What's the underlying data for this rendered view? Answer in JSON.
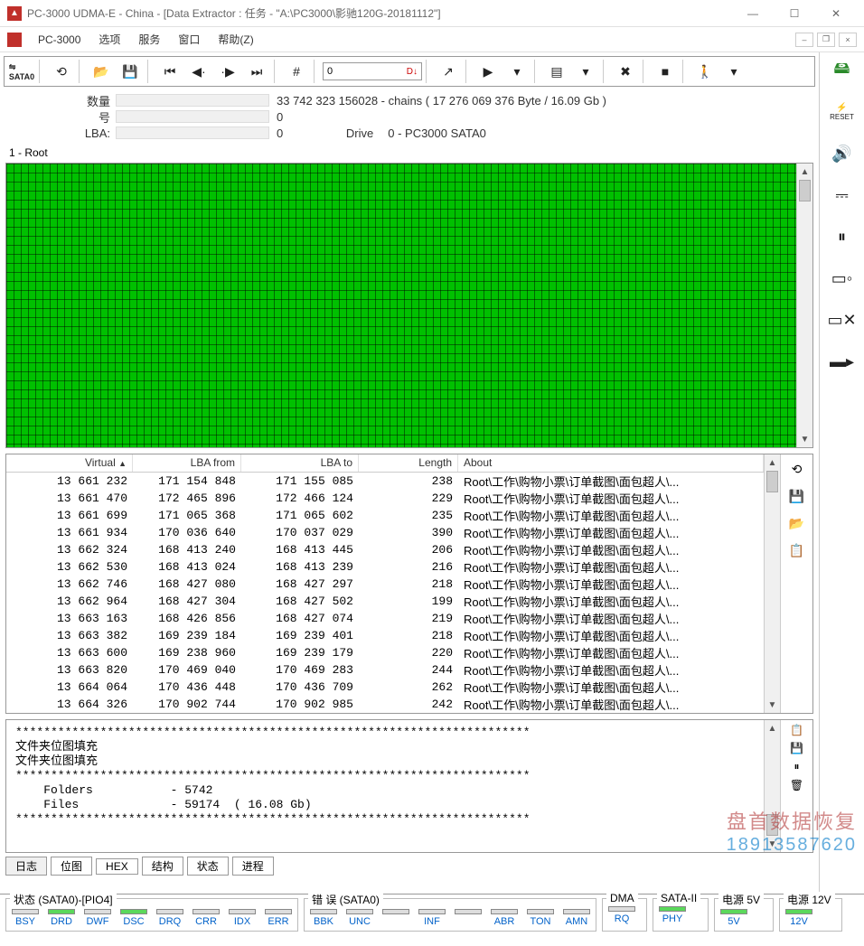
{
  "window": {
    "title": "PC-3000 UDMA-E - China - [Data Extractor : 任务 - \"A:\\PC3000\\影驰120G-20181112\"]"
  },
  "menubar": {
    "app": "PC-3000",
    "items": [
      "选项",
      "服务",
      "窗口",
      "帮助(Z)"
    ]
  },
  "toolbar": {
    "sata": "SATA0",
    "input_value": "0",
    "input_suffix": "D↓"
  },
  "info": {
    "count_label": "数量",
    "count_value": "33 742 323   156028 - chains   ( 17 276 069 376 Byte /  16.09 Gb )",
    "num_label": "号",
    "num_value": "0",
    "lba_label": "LBA:",
    "lba_value": "0",
    "drive_label": "Drive",
    "drive_value": "0 - PC3000 SATA0"
  },
  "root_label": "1 - Root",
  "table": {
    "headers": {
      "virtual": "Virtual",
      "lbafrom": "LBA from",
      "lbato": "LBA to",
      "length": "Length",
      "about": "About"
    },
    "rows": [
      {
        "virtual": "13 661 232",
        "lbafrom": "171 154 848",
        "lbato": "171 155 085",
        "length": "238",
        "about": "Root\\工作\\购物小票\\订单截图\\面包超人\\..."
      },
      {
        "virtual": "13 661 470",
        "lbafrom": "172 465 896",
        "lbato": "172 466 124",
        "length": "229",
        "about": "Root\\工作\\购物小票\\订单截图\\面包超人\\..."
      },
      {
        "virtual": "13 661 699",
        "lbafrom": "171 065 368",
        "lbato": "171 065 602",
        "length": "235",
        "about": "Root\\工作\\购物小票\\订单截图\\面包超人\\..."
      },
      {
        "virtual": "13 661 934",
        "lbafrom": "170 036 640",
        "lbato": "170 037 029",
        "length": "390",
        "about": "Root\\工作\\购物小票\\订单截图\\面包超人\\..."
      },
      {
        "virtual": "13 662 324",
        "lbafrom": "168 413 240",
        "lbato": "168 413 445",
        "length": "206",
        "about": "Root\\工作\\购物小票\\订单截图\\面包超人\\..."
      },
      {
        "virtual": "13 662 530",
        "lbafrom": "168 413 024",
        "lbato": "168 413 239",
        "length": "216",
        "about": "Root\\工作\\购物小票\\订单截图\\面包超人\\..."
      },
      {
        "virtual": "13 662 746",
        "lbafrom": "168 427 080",
        "lbato": "168 427 297",
        "length": "218",
        "about": "Root\\工作\\购物小票\\订单截图\\面包超人\\..."
      },
      {
        "virtual": "13 662 964",
        "lbafrom": "168 427 304",
        "lbato": "168 427 502",
        "length": "199",
        "about": "Root\\工作\\购物小票\\订单截图\\面包超人\\..."
      },
      {
        "virtual": "13 663 163",
        "lbafrom": "168 426 856",
        "lbato": "168 427 074",
        "length": "219",
        "about": "Root\\工作\\购物小票\\订单截图\\面包超人\\..."
      },
      {
        "virtual": "13 663 382",
        "lbafrom": "169 239 184",
        "lbato": "169 239 401",
        "length": "218",
        "about": "Root\\工作\\购物小票\\订单截图\\面包超人\\..."
      },
      {
        "virtual": "13 663 600",
        "lbafrom": "169 238 960",
        "lbato": "169 239 179",
        "length": "220",
        "about": "Root\\工作\\购物小票\\订单截图\\面包超人\\..."
      },
      {
        "virtual": "13 663 820",
        "lbafrom": "170 469 040",
        "lbato": "170 469 283",
        "length": "244",
        "about": "Root\\工作\\购物小票\\订单截图\\面包超人\\..."
      },
      {
        "virtual": "13 664 064",
        "lbafrom": "170 436 448",
        "lbato": "170 436 709",
        "length": "262",
        "about": "Root\\工作\\购物小票\\订单截图\\面包超人\\..."
      },
      {
        "virtual": "13 664 326",
        "lbafrom": "170 902 744",
        "lbato": "170 902 985",
        "length": "242",
        "about": "Root\\工作\\购物小票\\订单截图\\面包超人\\..."
      }
    ]
  },
  "log": {
    "lines": [
      "*************************************************************************",
      "文件夹位图填充",
      "文件夹位图填充",
      "*************************************************************************",
      "    Folders           - 5742",
      "    Files             - 59174  ( 16.08 Gb)",
      "*************************************************************************"
    ]
  },
  "tabs": {
    "items": [
      "日志",
      "位图",
      "HEX",
      "结构",
      "状态",
      "进程"
    ],
    "active": 0
  },
  "status": {
    "group1_title": "状态 (SATA0)-[PIO4]",
    "group2_title": "错 误 (SATA0)",
    "group3_title": "DMA",
    "group4_title": "SATA-II",
    "group5_title": "电源 5V",
    "group6_title": "电源 12V",
    "g1": [
      {
        "label": "BSY",
        "on": false
      },
      {
        "label": "DRD",
        "on": true
      },
      {
        "label": "DWF",
        "on": false
      },
      {
        "label": "DSC",
        "on": true
      },
      {
        "label": "DRQ",
        "on": false
      },
      {
        "label": "CRR",
        "on": false
      },
      {
        "label": "IDX",
        "on": false
      },
      {
        "label": "ERR",
        "on": false
      }
    ],
    "g2": [
      {
        "label": "BBK",
        "on": false
      },
      {
        "label": "UNC",
        "on": false
      },
      {
        "label": "",
        "on": false
      },
      {
        "label": "INF",
        "on": false
      },
      {
        "label": "",
        "on": false
      },
      {
        "label": "ABR",
        "on": false
      },
      {
        "label": "TON",
        "on": false
      },
      {
        "label": "AMN",
        "on": false
      }
    ],
    "g3": [
      {
        "label": "RQ",
        "on": false
      }
    ],
    "g4": [
      {
        "label": "PHY",
        "on": true
      }
    ],
    "g5": [
      {
        "label": "5V",
        "on": true
      }
    ],
    "g6": [
      {
        "label": "12V",
        "on": true
      }
    ]
  },
  "watermark": {
    "line1": "盘首数据恢复",
    "line2": "18913587620"
  }
}
